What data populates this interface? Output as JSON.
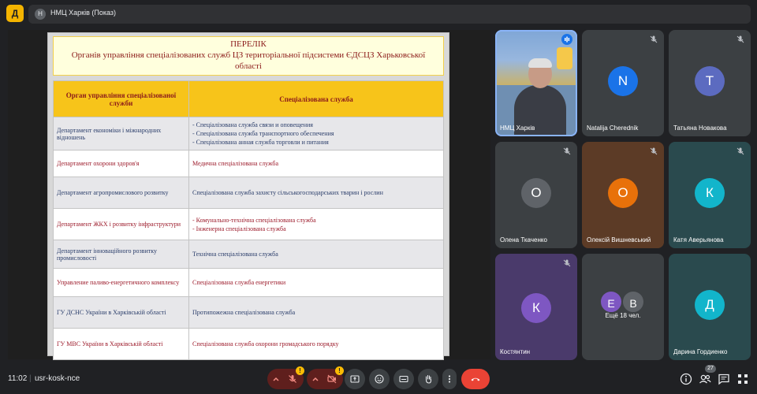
{
  "app": {
    "logo_letter": "Д"
  },
  "window": {
    "avatar_letter": "Н",
    "title": "НМЦ Харків (Показ)"
  },
  "slide": {
    "title_line1": "ПЕРЕЛІК",
    "title_line2": "Органів управління спеціалізованих  служб ЦЗ територіальної підсистеми ЄДСЦЗ Харьковської області",
    "columns": [
      "Орган управління спеціалізованої служби",
      "Спеціалізована служба"
    ],
    "rows": [
      {
        "org": "Департамент економіки і міжнародних відношень",
        "services": [
          "- Спеціалізована служба  связи и оповещения",
          "- Спеціалізована служба транспортного обеспечения",
          "- Спеціалізована анная служба торговли и питания"
        ]
      },
      {
        "org": "Департамент охорони здоров'я",
        "services": [
          "Медична  спеціалізована служба"
        ]
      },
      {
        "org": "Департамент агропромислового розвитку",
        "services": [
          "Спеціалізована служба захисту сільськогосподарських тварин і рослин"
        ]
      },
      {
        "org": "Департамент ЖКХ і розвитку інфраструктури",
        "services": [
          "- Комунально-технічна спеціалізована  служба",
          "- Інженерна спеціалізована  служба"
        ]
      },
      {
        "org": "Департамент інноваційного розвитку промисловості",
        "services": [
          "Технічна спеціалізована служба"
        ]
      },
      {
        "org": "Управление паливо-енергетичного комплексу",
        "services": [
          "Спеціалізована  служба енергетики"
        ]
      },
      {
        "org": "ГУ ДСНС України в Харківській області",
        "services": [
          "Протипожежна спеціалізована служба"
        ]
      },
      {
        "org": "ГУ МВС України в Харківській області",
        "services": [
          "Спеціалізована  служба охорони громадського порядку"
        ]
      }
    ]
  },
  "participants": [
    {
      "name": "НМЦ Харків",
      "initial": "",
      "color": "#6f8fb2",
      "speaking": true
    },
    {
      "name": "Natalija Cherednik",
      "initial": "N",
      "color": "#1a73e8",
      "muted": true
    },
    {
      "name": "Татьяна Новакова",
      "initial": "T",
      "color": "#5c6bc0",
      "muted": true
    },
    {
      "name": "Олена Ткаченко",
      "initial": "О",
      "color": "#5f6368",
      "muted": true
    },
    {
      "name": "Олексій Вишневський",
      "initial": "О",
      "color": "#e8710a",
      "muted": true
    },
    {
      "name": "Катя Аверьянова",
      "initial": "К",
      "color": "#12b5cb",
      "muted": true
    },
    {
      "name": "Костянтин",
      "initial": "К",
      "color": "#7e57c2",
      "muted": true
    },
    {
      "name": "Ещё 18 чел.",
      "initials": [
        "Е",
        "В"
      ],
      "colors": [
        "#7e57c2",
        "#5f6368"
      ]
    },
    {
      "name": "Дарина Гордиенко",
      "initial": "Д",
      "color": "#12b5cb"
    }
  ],
  "bottom": {
    "time": "11:02",
    "separator": "|",
    "meeting_code": "usr-kosk-nce",
    "mic_warning": "!",
    "cam_warning": "!",
    "participants_count": "27"
  },
  "colors": {
    "background": "#202124",
    "panel": "#3c4043",
    "hangup": "#ea4335",
    "warning": "#fbbc04"
  },
  "icons": [
    "chevron-up-icon",
    "mic-off-icon",
    "videocam-off-icon",
    "present-icon",
    "emoji-icon",
    "captions-icon",
    "raise-hand-icon",
    "more-vert-icon",
    "call-end-icon",
    "info-icon",
    "people-icon",
    "chat-icon",
    "activities-icon"
  ]
}
